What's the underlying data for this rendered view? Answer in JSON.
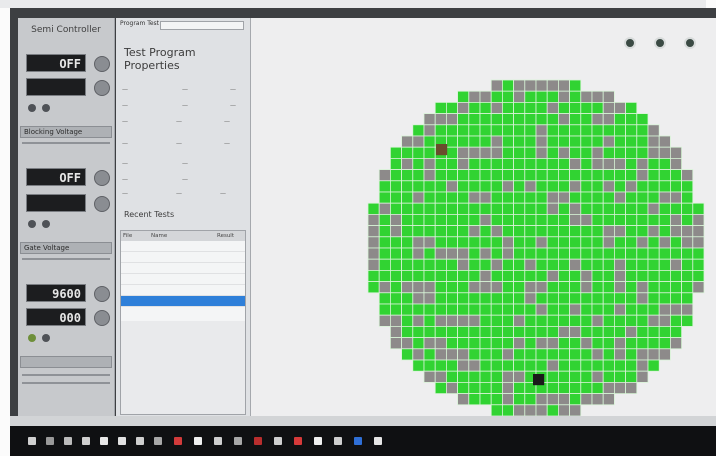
{
  "left_panel": {
    "title": "Semi Controller",
    "display1": "OFF",
    "display2": "",
    "ctrl1": {
      "label_a": "",
      "label_b": ""
    },
    "select1": "Blocking Voltage",
    "display3": "OFF",
    "display4": "",
    "ctrl2": {
      "label_a": "",
      "label_b": ""
    },
    "select2": "Gate Voltage",
    "display5": "9600",
    "display6": "000",
    "ctrl3": {
      "label_a": "",
      "label_b": ""
    },
    "select3": ""
  },
  "middle_panel": {
    "top_field_label": "Program Test",
    "top_field_value": "",
    "heading": "Test Program Properties",
    "col_a": "",
    "col_b": "",
    "section_heading": "Recent Tests",
    "table_headers": [
      "File",
      "Name",
      "Result"
    ],
    "table_rows": [
      {
        "id": "",
        "name": "",
        "result": ""
      },
      {
        "id": "",
        "name": "",
        "result": ""
      },
      {
        "id": "",
        "name": "",
        "result": ""
      },
      {
        "id": "",
        "name": "",
        "result": ""
      },
      {
        "id": "",
        "name": "",
        "result": ""
      },
      {
        "id": "",
        "name": "",
        "result": ""
      }
    ]
  },
  "toolbar": {
    "btn1_label": "",
    "btn2_label": "",
    "btn3_label": ""
  },
  "colors": {
    "pass": "#31d332",
    "fail": "#8d8a8a",
    "marker": "#1a1a1a",
    "marker_brown": "#6a4c2c",
    "grid_line": "#d7f3d6",
    "selection": "#2e7fd9"
  },
  "status": {
    "left": "",
    "mid": "",
    "right": ""
  }
}
